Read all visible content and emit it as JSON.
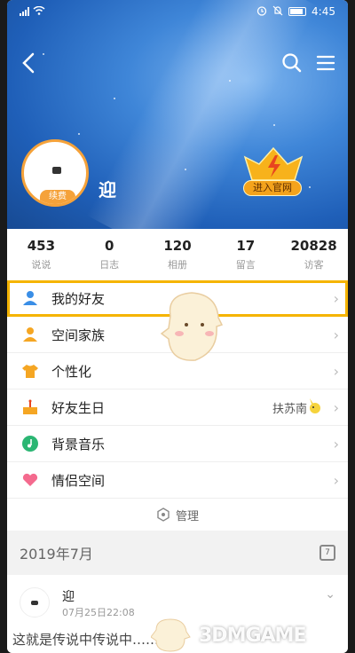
{
  "status_bar": {
    "time": "4:45",
    "battery": "88"
  },
  "profile": {
    "nickname": "迎",
    "renew_label": "续费",
    "official_button": "进入官网"
  },
  "stats": [
    {
      "value": "453",
      "label": "说说"
    },
    {
      "value": "0",
      "label": "日志"
    },
    {
      "value": "120",
      "label": "相册"
    },
    {
      "value": "17",
      "label": "留言"
    },
    {
      "value": "20828",
      "label": "访客"
    }
  ],
  "menu": [
    {
      "label": "我的好友",
      "icon": "friends-icon",
      "selected": true
    },
    {
      "label": "空间家族",
      "icon": "family-icon"
    },
    {
      "label": "个性化",
      "icon": "shirt-icon"
    },
    {
      "label": "好友生日",
      "icon": "cake-icon",
      "extra": "扶苏南"
    },
    {
      "label": "背景音乐",
      "icon": "music-icon"
    },
    {
      "label": "情侣空间",
      "icon": "heart-icon"
    }
  ],
  "manage_label": "管理",
  "month": "2019年7月",
  "calendar_day": "7",
  "feed": {
    "name": "迎",
    "time": "07月25日22:08",
    "preview": "这就是传说中传说中……"
  },
  "watermark": "3DMGAME",
  "colors": {
    "accent": "#f5b400",
    "banner": "#3f86d8"
  }
}
